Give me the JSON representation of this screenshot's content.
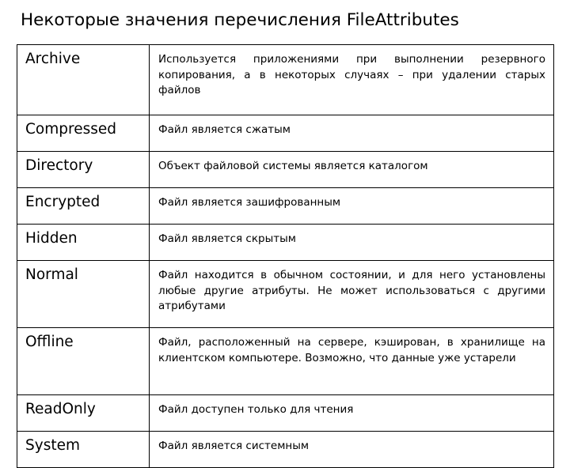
{
  "slide": {
    "title": "Некоторые значения перечисления FileAttributes",
    "table": {
      "rows": [
        {
          "name": "Archive",
          "description": "Используется приложениями при выполнении резервного копирования, а в некоторых случаях – при удалении старых файлов",
          "size": "tall"
        },
        {
          "name": "Compressed",
          "description": "Файл является сжатым",
          "size": "single"
        },
        {
          "name": "Directory",
          "description": "Объект файловой системы является каталогом",
          "size": "single"
        },
        {
          "name": "Encrypted",
          "description": "Файл является зашифрованным",
          "size": "single"
        },
        {
          "name": "Hidden",
          "description": "Файл является скрытым",
          "size": "single"
        },
        {
          "name": "Normal",
          "description": "Файл находится в обычном состоянии, и для него установлены любые другие атрибуты. Не может использоваться с другими атрибутами",
          "size": "tall"
        },
        {
          "name": "Offline",
          "description": "Файл, расположенный на сервере, кэширован, в хранилище на клиентском компьютере. Возможно, что данные уже устарели",
          "size": "tall"
        },
        {
          "name": "ReadOnly",
          "description": "Файл доступен только для чтения",
          "size": "single"
        },
        {
          "name": "System",
          "description": "Файл является системным",
          "size": "single"
        }
      ]
    }
  }
}
